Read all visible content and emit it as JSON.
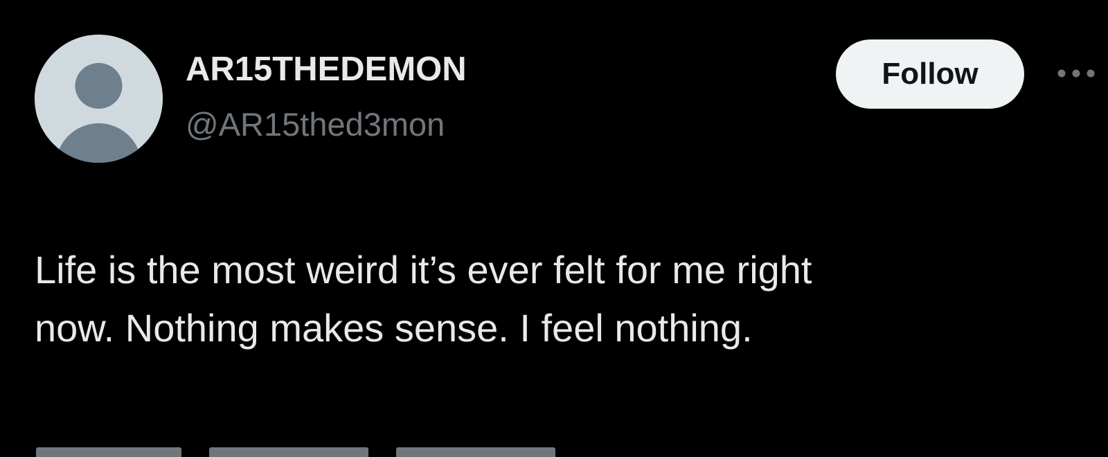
{
  "author": {
    "display_name": "AR15THEDEMON",
    "handle": "@AR15thed3mon",
    "avatar_icon": "default-profile-silhouette-icon"
  },
  "actions": {
    "follow_label": "Follow",
    "more_icon": "more-dots-icon"
  },
  "tweet": {
    "text_lines": [
      "Life is the most weird it’s ever felt for me right",
      "now. Nothing makes sense. I feel nothing."
    ]
  },
  "colors": {
    "background": "#000000",
    "primary_text": "#e7e9ea",
    "secondary_text": "#71767b",
    "follow_button_bg": "#eff3f4",
    "follow_button_text": "#0f1419",
    "avatar_bg": "#cfd9de",
    "avatar_figure": "#6e7f8d"
  }
}
